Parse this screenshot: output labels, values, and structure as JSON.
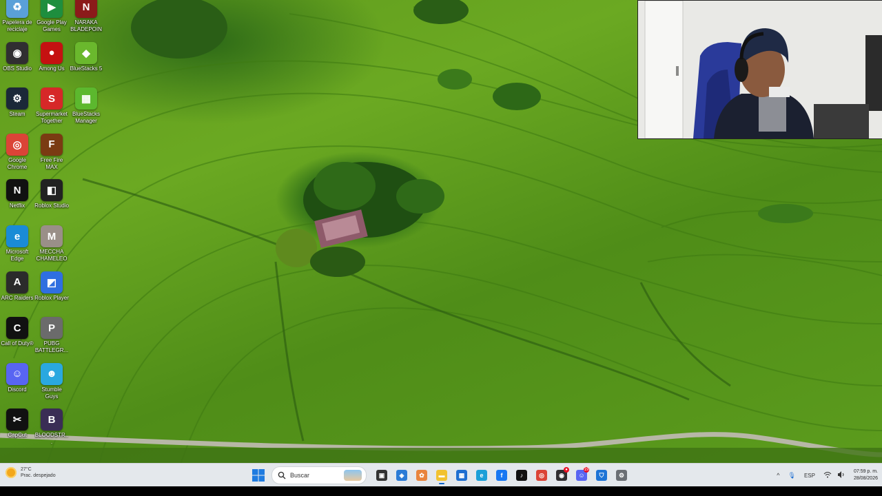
{
  "desktop": {
    "icons": [
      {
        "label": "Papelera de reciclaje",
        "icon": "recycle-bin-icon",
        "color": "#5aa0d8",
        "glyph": "♻"
      },
      {
        "label": "Google Play Games",
        "icon": "google-play-games-icon",
        "color": "#1e8e3e",
        "glyph": "▶"
      },
      {
        "label": "NARAKA BLADEPOINT",
        "icon": "naraka-icon",
        "color": "#8b1a1a",
        "glyph": "N"
      },
      {
        "label": "OBS Studio",
        "icon": "obs-icon",
        "color": "#302e31",
        "glyph": "◉"
      },
      {
        "label": "Among Us",
        "icon": "among-us-icon",
        "color": "#c51111",
        "glyph": "●"
      },
      {
        "label": "BlueStacks 5",
        "icon": "bluestacks-icon",
        "color": "#6ab82d",
        "glyph": "◆"
      },
      {
        "label": "Steam",
        "icon": "steam-icon",
        "color": "#1b2838",
        "glyph": "⚙"
      },
      {
        "label": "Supermarket Together",
        "icon": "supermarket-together-icon",
        "color": "#d62828",
        "glyph": "S"
      },
      {
        "label": "BlueStacks Manager",
        "icon": "bluestacks-manager-icon",
        "color": "#5cb82e",
        "glyph": "▦"
      },
      {
        "label": "Google Chrome",
        "icon": "chrome-icon",
        "color": "#db4437",
        "glyph": "◎"
      },
      {
        "label": "Free Fire MAX",
        "icon": "free-fire-icon",
        "color": "#7a3b12",
        "glyph": "F"
      },
      {
        "label": "Netflix",
        "icon": "netflix-icon",
        "color": "#111111",
        "glyph": "N"
      },
      {
        "label": "Roblox Studio",
        "icon": "roblox-studio-icon",
        "color": "#222222",
        "glyph": "◧"
      },
      {
        "label": "Microsoft Edge",
        "icon": "edge-icon",
        "color": "#1a8bd6",
        "glyph": "e"
      },
      {
        "label": "MECCHA CHAMELEON",
        "icon": "meccha-chameleon-icon",
        "color": "#9a8f88",
        "glyph": "M"
      },
      {
        "label": "ARC Raiders",
        "icon": "arc-raiders-icon",
        "color": "#2b2b2b",
        "glyph": "A"
      },
      {
        "label": "Roblox Player",
        "icon": "roblox-player-icon",
        "color": "#2f6fe0",
        "glyph": "◩"
      },
      {
        "label": "Call of Duty®",
        "icon": "call-of-duty-icon",
        "color": "#111111",
        "glyph": "C"
      },
      {
        "label": "PUBG BATTLEGR...",
        "icon": "pubg-icon",
        "color": "#6b6b6b",
        "glyph": "P"
      },
      {
        "label": "Discord",
        "icon": "discord-icon",
        "color": "#5865f2",
        "glyph": "☺"
      },
      {
        "label": "Stumble Guys",
        "icon": "stumble-guys-icon",
        "color": "#2aa8e0",
        "glyph": "☻"
      },
      {
        "label": "CapCut",
        "icon": "capcut-icon",
        "color": "#111111",
        "glyph": "✂"
      },
      {
        "label": "BLOODSTR...",
        "icon": "bloodstrike-icon",
        "color": "#3a2d55",
        "glyph": "B"
      }
    ]
  },
  "taskbar": {
    "weather": {
      "temp": "27°C",
      "condition": "Prac. despejado"
    },
    "search_placeholder": "Buscar",
    "apps": [
      {
        "name": "task-view-icon",
        "color": "#333333",
        "glyph": "▣"
      },
      {
        "name": "copilot-icon",
        "color": "#2b7bd6",
        "glyph": "◈"
      },
      {
        "name": "photos-icon",
        "color": "#e9843d",
        "glyph": "✿"
      },
      {
        "name": "file-explorer-icon",
        "color": "#f2c230",
        "glyph": "▬",
        "active": true
      },
      {
        "name": "microsoft-store-icon",
        "color": "#1f6fd1",
        "glyph": "▦"
      },
      {
        "name": "edge-icon",
        "color": "#1a9fd8",
        "glyph": "e"
      },
      {
        "name": "facebook-icon",
        "color": "#1877f2",
        "glyph": "f"
      },
      {
        "name": "tiktok-icon",
        "color": "#111111",
        "glyph": "♪"
      },
      {
        "name": "chrome-icon",
        "color": "#db4437",
        "glyph": "◎"
      },
      {
        "name": "obs-icon",
        "color": "#302e31",
        "glyph": "◉",
        "badge": "●"
      },
      {
        "name": "discord-icon",
        "color": "#5865f2",
        "glyph": "☺",
        "badge": "19"
      },
      {
        "name": "security-icon",
        "color": "#1e74d6",
        "glyph": "⛉"
      },
      {
        "name": "settings-icon",
        "color": "#6b6f74",
        "glyph": "⚙"
      }
    ],
    "tray": {
      "chevron": "^",
      "mic": "🎙",
      "language": "ESP",
      "time": "07:59 p. m.",
      "date": "28/08/2026"
    }
  }
}
